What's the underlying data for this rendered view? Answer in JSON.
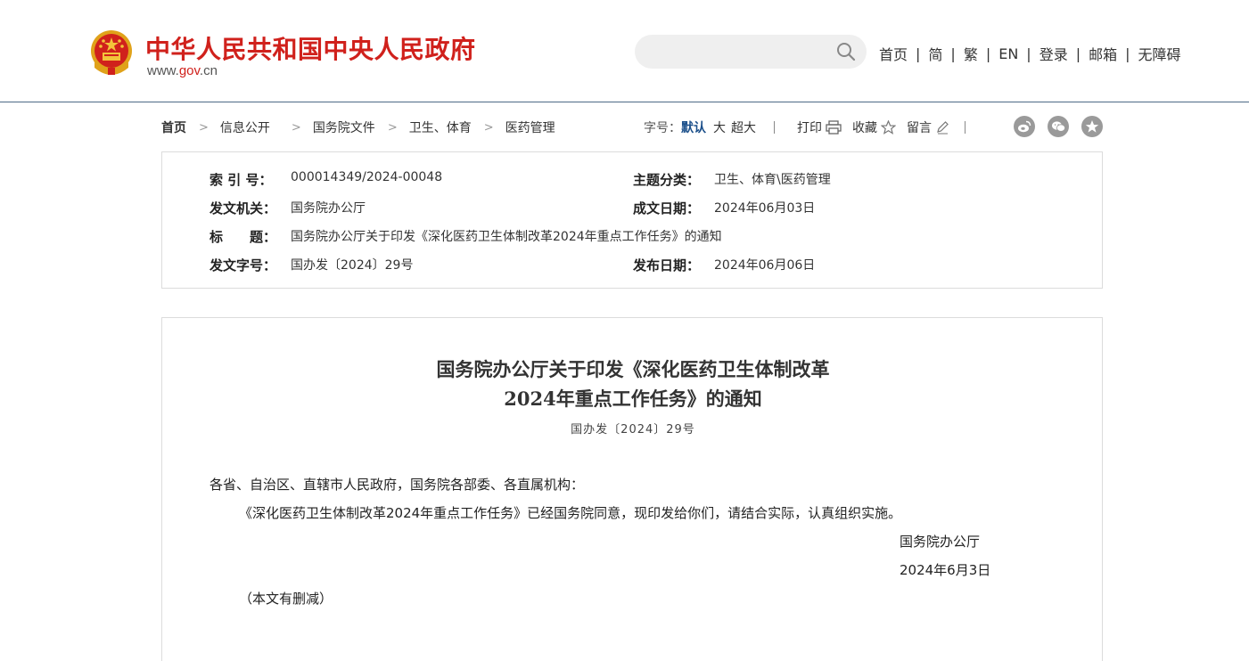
{
  "header": {
    "site_title": "中华人民共和国中央人民政府",
    "site_url_prefix": "www.",
    "site_url_mid": "gov",
    "site_url_suffix": ".cn",
    "search_placeholder": "",
    "nav": [
      "首页",
      "简",
      "繁",
      "EN",
      "登录",
      "邮箱",
      "无障碍"
    ],
    "nav_sep": "|"
  },
  "breadcrumb": {
    "items": [
      "首页",
      "信息公开",
      "国务院文件",
      "卫生、体育",
      "医药管理"
    ],
    "arrow": ">"
  },
  "toolbar": {
    "font_size_label": "字号：",
    "font_default": "默认",
    "font_large": "大",
    "font_xlarge": "超大",
    "print": "打印",
    "favorite": "收藏",
    "comment": "留言"
  },
  "share_icons": [
    "weibo-icon",
    "wechat-icon",
    "qzone-icon"
  ],
  "info": {
    "index_label": "索 引 号：",
    "index_value": "000014349/2024-00048",
    "category_label": "主题分类：",
    "category_value": "卫生、体育\\医药管理",
    "issuer_label": "发文机关：",
    "issuer_value": "国务院办公厅",
    "written_date_label": "成文日期：",
    "written_date_value": "2024年06月03日",
    "title_label": "标　　题：",
    "title_value": "国务院办公厅关于印发《深化医药卫生体制改革2024年重点工作任务》的通知",
    "doc_number_label": "发文字号：",
    "doc_number_value": "国办发〔2024〕29号",
    "publish_date_label": "发布日期：",
    "publish_date_value": "2024年06月06日"
  },
  "article": {
    "title_line1": "国务院办公厅关于印发《深化医药卫生体制改革",
    "title_line2": "2024年重点工作任务》的通知",
    "doc_number": "国办发〔2024〕29号",
    "salutation": "各省、自治区、直辖市人民政府，国务院各部委、各直属机构：",
    "body": "《深化医药卫生体制改革2024年重点工作任务》已经国务院同意，现印发给你们，请结合实际，认真组织实施。",
    "signature": "国务院办公厅",
    "date": "2024年6月3日",
    "note": "（本文有删减）"
  },
  "colors": {
    "brand_red": "#d0211c",
    "link_blue": "#1b4f8a",
    "header_line": "#4d6a86"
  }
}
